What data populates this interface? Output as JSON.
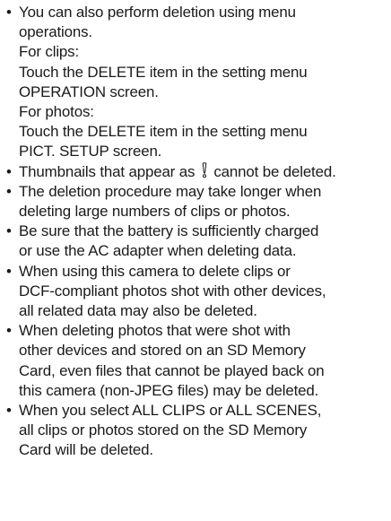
{
  "bullet_glyph": "•",
  "notes": [
    {
      "lines": [
        "You can also perform deletion using menu",
        "operations.",
        "For clips:",
        "Touch the DELETE item in the setting menu",
        "OPERATION screen.",
        "For photos:",
        "Touch the DELETE item in the setting menu",
        "PICT. SETUP screen."
      ]
    },
    {
      "before_icon": "Thumbnails that appear as ",
      "icon": "warning-exclamation-icon",
      "after_icon": " cannot be deleted."
    },
    {
      "lines": [
        "The deletion procedure may take longer when",
        "deleting large numbers of clips or photos."
      ]
    },
    {
      "lines": [
        "Be sure that the battery is sufficiently charged",
        "or use the AC adapter when deleting data."
      ]
    },
    {
      "lines": [
        "When using this camera to delete clips or",
        "DCF-compliant photos shot with other devices,",
        "all related data may also be deleted."
      ]
    },
    {
      "lines": [
        "When deleting photos that were shot with",
        "other devices and stored on an SD Memory",
        "Card, even files that cannot be played back on",
        "this camera (non-JPEG files) may be deleted."
      ]
    },
    {
      "lines": [
        "When you select ALL CLIPS or ALL SCENES,",
        "all clips or photos stored on the SD Memory",
        "Card will be deleted."
      ]
    }
  ]
}
